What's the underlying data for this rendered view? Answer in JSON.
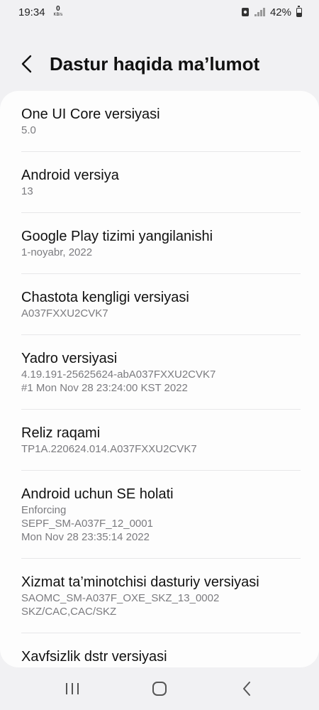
{
  "status_bar": {
    "time": "19:34",
    "net_speed_value": "0",
    "net_speed_unit": "KB/s",
    "battery": "42%",
    "battery_level": 0.42
  },
  "header": {
    "title": "Dastur haqida ma’lumot"
  },
  "items": [
    {
      "title": "One UI Core versiyasi",
      "value": "5.0"
    },
    {
      "title": "Android versiya",
      "value": "13"
    },
    {
      "title": "Google Play tizimi yangilanishi",
      "value": "1-noyabr, 2022"
    },
    {
      "title": "Chastota kengligi versiyasi",
      "value": "A037FXXU2CVK7"
    },
    {
      "title": "Yadro versiyasi",
      "value": "4.19.191-25625624-abA037FXXU2CVK7\n#1 Mon Nov 28 23:24:00 KST 2022"
    },
    {
      "title": "Reliz raqami",
      "value": "TP1A.220624.014.A037FXXU2CVK7"
    },
    {
      "title": "Android uchun SE holati",
      "value": "Enforcing\nSEPF_SM-A037F_12_0001\nMon Nov 28 23:35:14 2022"
    },
    {
      "title": "Xizmat ta’minotchisi dasturiy versiyasi",
      "value": "SAOMC_SM-A037F_OXE_SKZ_13_0002\nSKZ/CAC,CAC/SKZ"
    },
    {
      "title": "Xavfsizlik dstr versiyasi",
      "value": ""
    }
  ],
  "nav_bar": {
    "recents_icon": "recents-icon",
    "home_icon": "home-icon",
    "back_icon": "back-icon"
  }
}
